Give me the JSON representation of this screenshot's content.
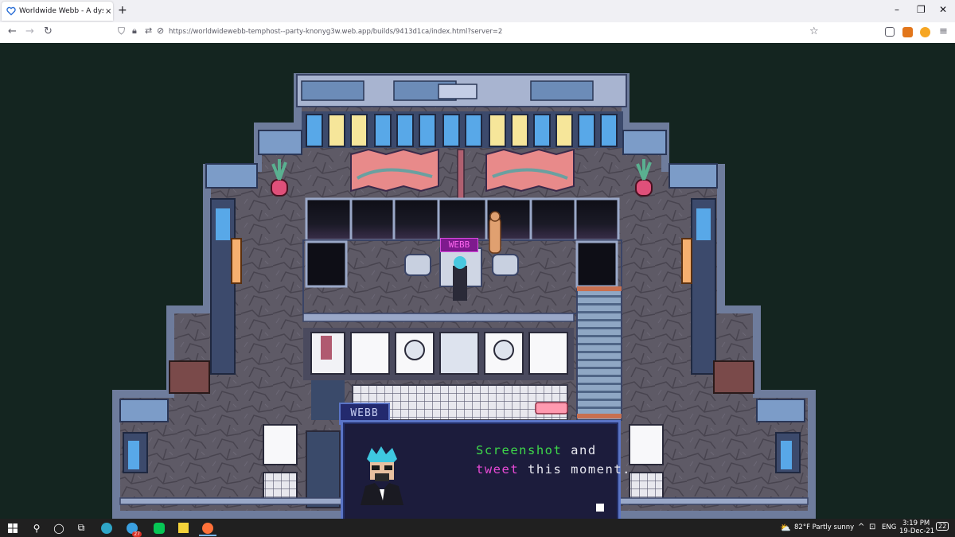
{
  "browser": {
    "tab_title": "Worldwide Webb - A dystopian",
    "tab_close": "×",
    "new_tab": "+",
    "url": "https://worldwidewebb-temphost--party-knonyg3w.web.app/builds/9413d1ca/index.html?server=2",
    "icons": [
      "back-icon",
      "forward-icon",
      "reload-icon",
      "shield-icon",
      "lock-icon",
      "permissions-icon",
      "bookmark-star-icon",
      "pocket-icon",
      "metamask-icon",
      "extension-icon",
      "menu-icon"
    ]
  },
  "game": {
    "name_tag": "WEBB",
    "dialogue": {
      "speaker": "WEBB",
      "line1": [
        {
          "text": "Screenshot",
          "color": "#3ed84a"
        },
        {
          "text": " and",
          "color": "#e8e8f0"
        }
      ],
      "line2": [
        {
          "text": "tweet",
          "color": "#e84ad6"
        },
        {
          "text": " this moment.",
          "color": "#e8e8f0"
        }
      ]
    }
  },
  "taskbar": {
    "weather": "82°F  Partly sunny",
    "lang": "ENG",
    "time": "3:19 PM",
    "date": "19-Dec-21",
    "notifications": "22",
    "badge": "27"
  }
}
